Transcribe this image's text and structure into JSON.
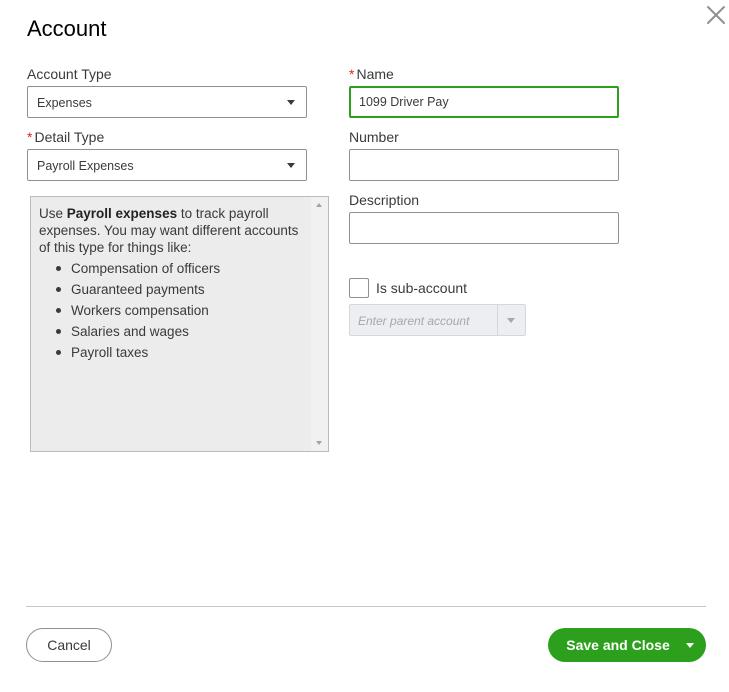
{
  "dialog": {
    "title": "Account"
  },
  "form": {
    "account_type": {
      "label": "Account Type",
      "value": "Expenses"
    },
    "detail_type": {
      "required_mark": "*",
      "label": "Detail Type",
      "value": "Payroll Expenses"
    },
    "name": {
      "required_mark": "*",
      "label": "Name",
      "value": "1099 Driver Pay"
    },
    "number": {
      "label": "Number",
      "value": ""
    },
    "description": {
      "label": "Description",
      "value": ""
    },
    "sub_account": {
      "label": "Is sub-account",
      "checked": false
    },
    "parent_account": {
      "placeholder": "Enter parent account"
    }
  },
  "help": {
    "prefix": "Use ",
    "bold": "Payroll expenses",
    "suffix": " to track payroll expenses. You may want different accounts of this type for things like:",
    "items": [
      "Compensation of officers",
      "Guaranteed payments",
      "Workers compensation",
      "Salaries and wages",
      "Payroll taxes"
    ]
  },
  "footer": {
    "cancel_label": "Cancel",
    "save_label": "Save and Close"
  },
  "colors": {
    "accent": "#2ca01c",
    "required": "#d52b1e"
  },
  "icons": {
    "close": "close-icon",
    "dropdown": "caret-down-icon"
  }
}
